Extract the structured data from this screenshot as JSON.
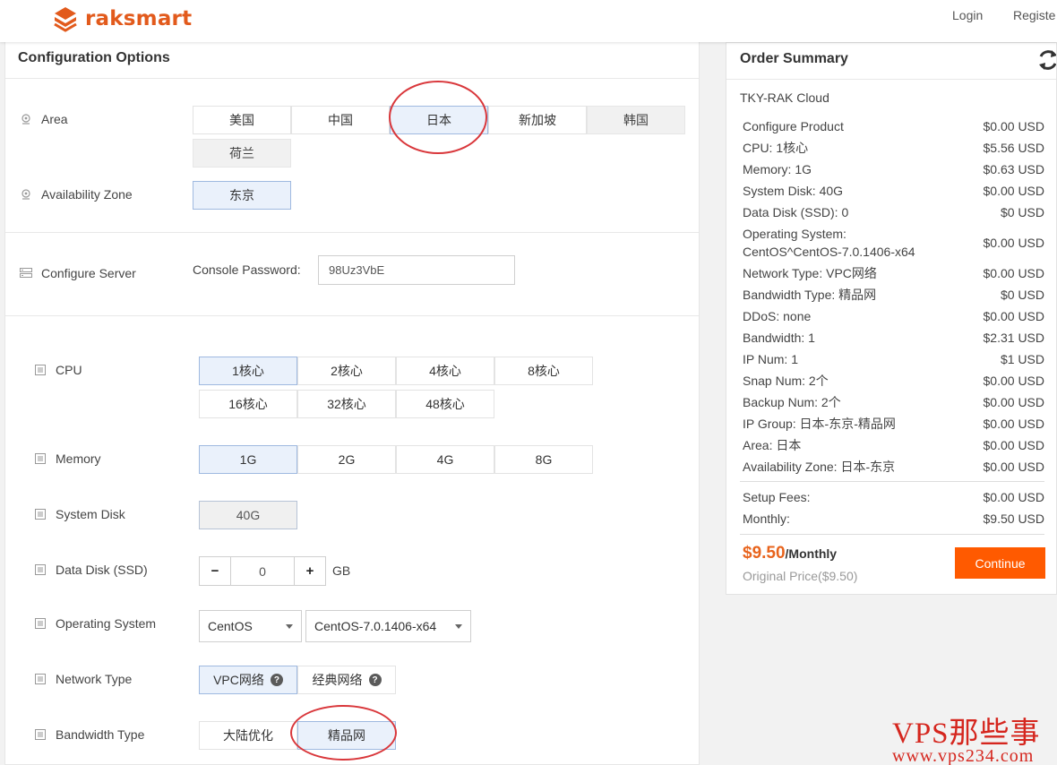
{
  "header": {
    "brand": "raksmart",
    "login": "Login",
    "register": "Registe"
  },
  "config": {
    "title": "Configuration Options",
    "area": {
      "label": "Area",
      "options": [
        "美国",
        "中国",
        "日本",
        "新加坡",
        "韩国",
        "荷兰"
      ],
      "selected": "日本"
    },
    "zone": {
      "label": "Availability Zone",
      "options": [
        "东京"
      ],
      "selected": "东京"
    },
    "server": {
      "label": "Configure Server",
      "password_label": "Console Password:",
      "password_value": "98Uz3VbE"
    },
    "cpu": {
      "label": "CPU",
      "options": [
        "1核心",
        "2核心",
        "4核心",
        "8核心",
        "16核心",
        "32核心",
        "48核心"
      ],
      "selected": "1核心"
    },
    "memory": {
      "label": "Memory",
      "options": [
        "1G",
        "2G",
        "4G",
        "8G"
      ],
      "selected": "1G"
    },
    "system_disk": {
      "label": "System Disk",
      "value": "40G"
    },
    "data_disk": {
      "label": "Data Disk (SSD)",
      "minus": "−",
      "value": "0",
      "plus": "+",
      "unit": "GB"
    },
    "os": {
      "label": "Operating System",
      "family": "CentOS",
      "version": "CentOS-7.0.1406-x64"
    },
    "network": {
      "label": "Network Type",
      "options": [
        "VPC网络",
        "经典网络"
      ],
      "selected": "VPC网络",
      "help": "?"
    },
    "bandwidth_type": {
      "label": "Bandwidth Type",
      "options": [
        "大陆优化",
        "精品网"
      ],
      "selected": "精品网"
    }
  },
  "summary": {
    "title": "Order Summary",
    "product": "TKY-RAK Cloud",
    "rows": [
      {
        "label": "Configure Product",
        "price": "$0.00 USD"
      },
      {
        "label": "CPU: 1核心",
        "price": "$5.56 USD"
      },
      {
        "label": "Memory: 1G",
        "price": "$0.63 USD"
      },
      {
        "label": "System Disk: 40G",
        "price": "$0.00 USD"
      },
      {
        "label": "Data Disk (SSD): 0",
        "price": "$0 USD"
      },
      {
        "label": "Operating System:",
        "label2": "CentOS^CentOS-7.0.1406-x64",
        "price": "$0.00 USD"
      },
      {
        "label": "Network Type: VPC网络",
        "price": "$0.00 USD"
      },
      {
        "label": "Bandwidth Type: 精品网",
        "price": "$0 USD"
      },
      {
        "label": "DDoS: none",
        "price": "$0.00 USD"
      },
      {
        "label": "Bandwidth: 1",
        "price": "$2.31 USD"
      },
      {
        "label": "IP Num: 1",
        "price": "$1 USD"
      },
      {
        "label": "Snap Num: 2个",
        "price": "$0.00 USD"
      },
      {
        "label": "Backup Num: 2个",
        "price": "$0.00 USD"
      },
      {
        "label": "IP Group: 日本-东京-精品网",
        "price": "$0.00 USD"
      },
      {
        "label": "Area: 日本",
        "price": "$0.00 USD"
      },
      {
        "label": "Availability Zone: 日本-东京",
        "price": "$0.00 USD"
      }
    ],
    "setup_label": "Setup Fees:",
    "setup_value": "$0.00 USD",
    "monthly_label": "Monthly:",
    "monthly_value": "$9.50 USD",
    "total": "$9.50",
    "per": "/Monthly",
    "original": "Original Price($9.50)",
    "continue": "Continue"
  },
  "watermark": {
    "line1": "VPS那些事",
    "line2": "www.vps234.com"
  },
  "colors": {
    "accent": "#ff5a00",
    "price": "#e8641d",
    "selected_bg": "#eaf1fb",
    "selected_border": "#9fb9e0",
    "annotation": "#d9373b"
  }
}
